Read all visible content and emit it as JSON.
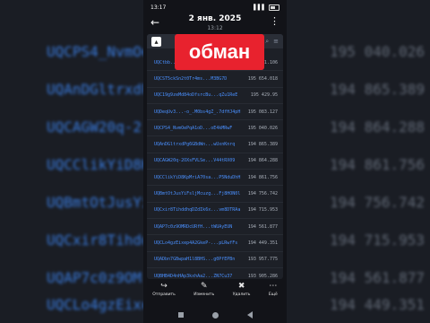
{
  "background": {
    "rows": [
      {
        "address": "UQCPS4_NvmOeP",
        "value": "195 040.026"
      },
      {
        "address": "UQAnDGltrxdPg",
        "value": "194 865.389"
      },
      {
        "address": "UQCAGW20q-2",
        "value": "194 864.288"
      },
      {
        "address": "UQCClikYiD8Kp",
        "value": "194 861.756"
      },
      {
        "address": "UQBmtOtJusYil",
        "value": "194 756.742"
      },
      {
        "address": "UQCxir8Tihddh",
        "value": "194 715.953"
      },
      {
        "address": "UQAP7c0z9OM",
        "value": "194 561.877"
      },
      {
        "address": "UQCLo4gzEixep",
        "value": "194 449.351"
      }
    ]
  },
  "status_bar": {
    "time": "13:17",
    "icons": "✉ ↓ •",
    "signal": "▌▌▌"
  },
  "header": {
    "back": "←",
    "date": "2 янв. 2025",
    "time": "13:12",
    "more": "⋮"
  },
  "document": {
    "logo": "▴",
    "tool_icons": [
      "⌕",
      "≡"
    ],
    "rows": [
      {
        "address": "UQCtbb...",
        "value": "195 721.106"
      },
      {
        "address": "UQCST5ckSn2t0Tr4ms...M3BG7D",
        "value": "195 654.018"
      },
      {
        "address": "UQC19g9zeMd84oDfsrcBu...qZu1ReE",
        "value": "195 429.95"
      },
      {
        "address": "UQDeqUv3...-o_.M0bs4gZ_.7dfHJ4pH",
        "value": "195 083.127"
      },
      {
        "address": "UQCPS4_NvmOePqA1oD...oE4kMRwF",
        "value": "195 040.026"
      },
      {
        "address": "UQAnDGltrxdPg6GBdWn...wUxnKnrq",
        "value": "194 865.389"
      },
      {
        "address": "UQCAGW20q-2OXsFVLSe...V44tRX09",
        "value": "194 864.288"
      },
      {
        "address": "UQCClikYiD8KpMriA70sa...P5NduDhH",
        "value": "194 861.756"
      },
      {
        "address": "UQBmtOtJusYiFsljMcuzg...Fj8HON0l",
        "value": "194 756.742"
      },
      {
        "address": "UQCxir8TihddhqDZdIk6x...vm8DTRAa",
        "value": "194 715.953"
      },
      {
        "address": "UQAP7c0z9OMRDcURfH...tWUAyEUN",
        "value": "194 561.877"
      },
      {
        "address": "UQCLo4gzEixep4A2GkeP-...pLRwfFs",
        "value": "194 449.351"
      },
      {
        "address": "UQADbn7GBwpaH1l8BHS...g0PfEPBn",
        "value": "193 957.775"
      },
      {
        "address": "UQBHB4D4nHAp3kxhAa2...ZN7Cu37",
        "value": "193 905.286"
      },
      {
        "address": "UQBko4qZLIDwVUMmpyI...Mqy6QPPg",
        "value": "193 865.191"
      },
      {
        "address": "UQCwV1ueWBOzl2t4V9...O4fTON3r",
        "value": "193 840.961"
      },
      {
        "address": "UQD2YjjIXMFBMY7Wocou...PCyNTNfh",
        "value": "193 695.326"
      }
    ]
  },
  "toolbar": [
    {
      "icon": "↪",
      "label": "Отправить",
      "name": "share-button"
    },
    {
      "icon": "✎",
      "label": "Изменить",
      "name": "edit-button"
    },
    {
      "icon": "✖",
      "label": "Удалить",
      "name": "delete-button"
    },
    {
      "icon": "⋯",
      "label": "Ещё",
      "name": "more-button"
    }
  ],
  "overlay": {
    "text": "обман",
    "color": "#e8222e"
  }
}
